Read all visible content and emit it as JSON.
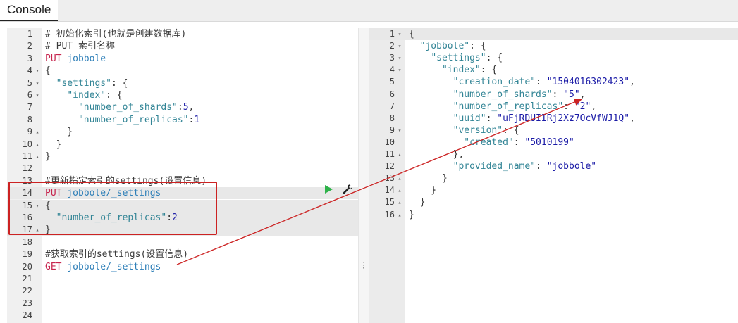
{
  "tab": {
    "label": "Console"
  },
  "request": {
    "lines": [
      [
        {
          "t": "# 初始化索引(也就是创建数据库)",
          "c": "comment"
        }
      ],
      [
        {
          "t": "# PUT 索引名称",
          "c": "comment"
        }
      ],
      [
        {
          "t": "PUT ",
          "c": "method"
        },
        {
          "t": "jobbole",
          "c": "url"
        }
      ],
      [
        {
          "t": "{",
          "c": "punc"
        }
      ],
      [
        {
          "t": "  ",
          "c": "punc"
        },
        {
          "t": "\"settings\"",
          "c": "key"
        },
        {
          "t": ": {",
          "c": "punc"
        }
      ],
      [
        {
          "t": "    ",
          "c": "punc"
        },
        {
          "t": "\"index\"",
          "c": "key"
        },
        {
          "t": ": {",
          "c": "punc"
        }
      ],
      [
        {
          "t": "      ",
          "c": "punc"
        },
        {
          "t": "\"number_of_shards\"",
          "c": "key"
        },
        {
          "t": ":",
          "c": "punc"
        },
        {
          "t": "5",
          "c": "num"
        },
        {
          "t": ",",
          "c": "punc"
        }
      ],
      [
        {
          "t": "      ",
          "c": "punc"
        },
        {
          "t": "\"number_of_replicas\"",
          "c": "key"
        },
        {
          "t": ":",
          "c": "punc"
        },
        {
          "t": "1",
          "c": "num"
        }
      ],
      [
        {
          "t": "    }",
          "c": "punc"
        }
      ],
      [
        {
          "t": "  }",
          "c": "punc"
        }
      ],
      [
        {
          "t": "}",
          "c": "punc"
        }
      ],
      [],
      [
        {
          "t": "#更新指定索引的settings(设置信息)",
          "c": "comment"
        }
      ],
      [
        {
          "t": "PUT ",
          "c": "method"
        },
        {
          "t": "jobbole/_settings",
          "c": "url"
        }
      ],
      [
        {
          "t": "{",
          "c": "punc"
        }
      ],
      [
        {
          "t": "  ",
          "c": "punc"
        },
        {
          "t": "\"number_of_replicas\"",
          "c": "key"
        },
        {
          "t": ":",
          "c": "punc"
        },
        {
          "t": "2",
          "c": "num"
        }
      ],
      [
        {
          "t": "}",
          "c": "punc"
        }
      ],
      [],
      [
        {
          "t": "#获取索引的settings(设置信息)",
          "c": "comment"
        }
      ],
      [
        {
          "t": "GET ",
          "c": "method"
        },
        {
          "t": "jobbole/_settings",
          "c": "url"
        }
      ],
      [],
      [],
      [],
      []
    ],
    "folds": {
      "4": "down",
      "5": "down",
      "6": "down",
      "9": "up",
      "10": "up",
      "11": "up",
      "15": "down",
      "17": "up"
    },
    "highlight_lines": [
      14,
      15,
      16,
      17
    ],
    "cursor_line": 14
  },
  "response": {
    "lines": [
      [
        {
          "t": "{",
          "c": "punc"
        }
      ],
      [
        {
          "t": "  ",
          "c": "punc"
        },
        {
          "t": "\"jobbole\"",
          "c": "key"
        },
        {
          "t": ": {",
          "c": "punc"
        }
      ],
      [
        {
          "t": "    ",
          "c": "punc"
        },
        {
          "t": "\"settings\"",
          "c": "key"
        },
        {
          "t": ": {",
          "c": "punc"
        }
      ],
      [
        {
          "t": "      ",
          "c": "punc"
        },
        {
          "t": "\"index\"",
          "c": "key"
        },
        {
          "t": ": {",
          "c": "punc"
        }
      ],
      [
        {
          "t": "        ",
          "c": "punc"
        },
        {
          "t": "\"creation_date\"",
          "c": "key"
        },
        {
          "t": ": ",
          "c": "punc"
        },
        {
          "t": "\"1504016302423\"",
          "c": "str"
        },
        {
          "t": ",",
          "c": "punc"
        }
      ],
      [
        {
          "t": "        ",
          "c": "punc"
        },
        {
          "t": "\"number_of_shards\"",
          "c": "key"
        },
        {
          "t": ": ",
          "c": "punc"
        },
        {
          "t": "\"5\"",
          "c": "str"
        },
        {
          "t": ",",
          "c": "punc"
        }
      ],
      [
        {
          "t": "        ",
          "c": "punc"
        },
        {
          "t": "\"number_of_replicas\"",
          "c": "key"
        },
        {
          "t": ": ",
          "c": "punc"
        },
        {
          "t": "\"2\"",
          "c": "str"
        },
        {
          "t": ",",
          "c": "punc"
        }
      ],
      [
        {
          "t": "        ",
          "c": "punc"
        },
        {
          "t": "\"uuid\"",
          "c": "key"
        },
        {
          "t": ": ",
          "c": "punc"
        },
        {
          "t": "\"uFjRDUIIRj2Xz7OcVfWJ1Q\"",
          "c": "str"
        },
        {
          "t": ",",
          "c": "punc"
        }
      ],
      [
        {
          "t": "        ",
          "c": "punc"
        },
        {
          "t": "\"version\"",
          "c": "key"
        },
        {
          "t": ": {",
          "c": "punc"
        }
      ],
      [
        {
          "t": "          ",
          "c": "punc"
        },
        {
          "t": "\"created\"",
          "c": "key"
        },
        {
          "t": ": ",
          "c": "punc"
        },
        {
          "t": "\"5010199\"",
          "c": "str"
        }
      ],
      [
        {
          "t": "        },",
          "c": "punc"
        }
      ],
      [
        {
          "t": "        ",
          "c": "punc"
        },
        {
          "t": "\"provided_name\"",
          "c": "key"
        },
        {
          "t": ": ",
          "c": "punc"
        },
        {
          "t": "\"jobbole\"",
          "c": "str"
        }
      ],
      [
        {
          "t": "      }",
          "c": "punc"
        }
      ],
      [
        {
          "t": "    }",
          "c": "punc"
        }
      ],
      [
        {
          "t": "  }",
          "c": "punc"
        }
      ],
      [
        {
          "t": "}",
          "c": "punc"
        }
      ]
    ],
    "folds": {
      "1": "down",
      "2": "down",
      "3": "down",
      "4": "down",
      "9": "down",
      "11": "up",
      "13": "up",
      "14": "up",
      "15": "up",
      "16": "up"
    },
    "highlight_lines": [
      1
    ]
  },
  "colors": {
    "annotation": "#cc2222",
    "run_button": "#2eb24a"
  },
  "icons": {
    "run": "play-icon",
    "settings": "wrench-icon"
  }
}
